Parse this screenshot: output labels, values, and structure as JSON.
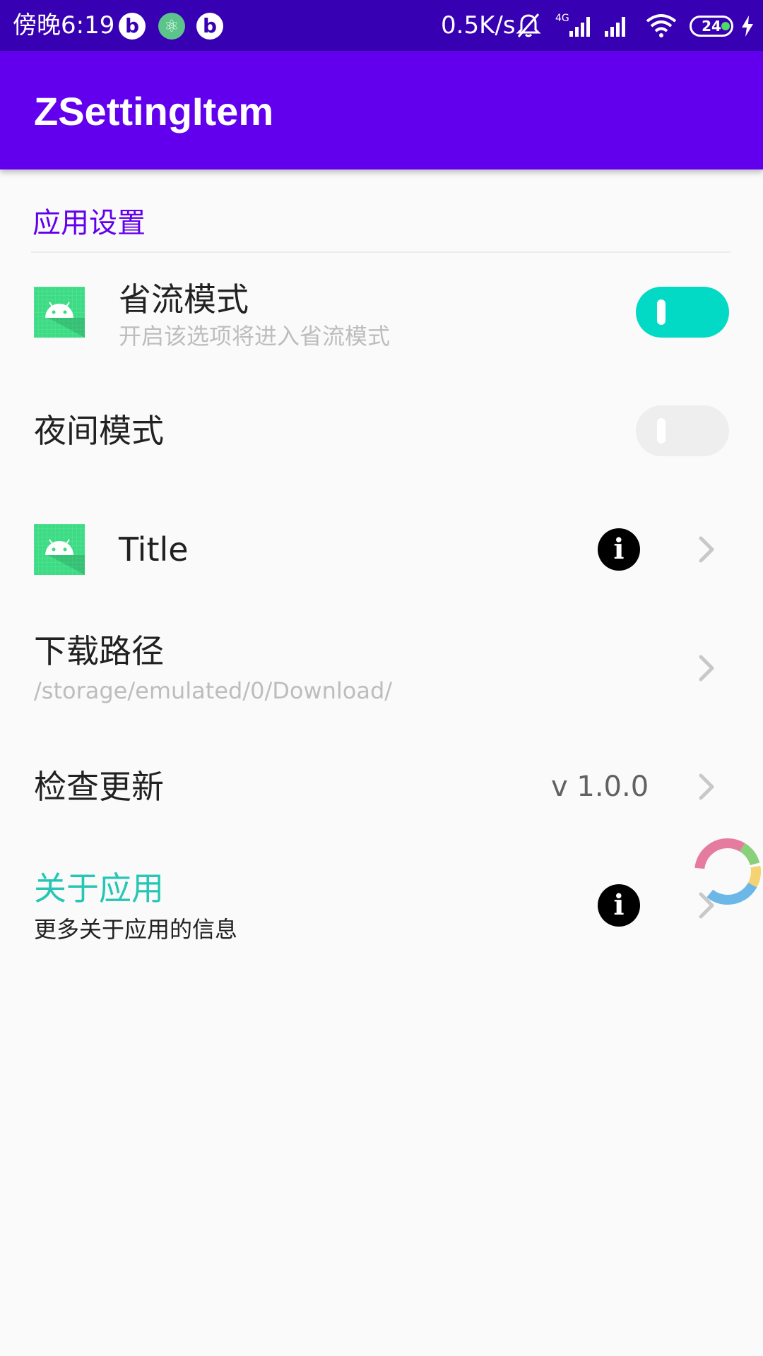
{
  "status_bar": {
    "time": "傍晚6:19",
    "network_speed": "0.5K/s",
    "battery_level": "24",
    "icons": [
      "bilibili-icon",
      "atom-icon",
      "bilibili-icon",
      "mute-bell-icon",
      "4g-signal-icon",
      "signal-icon",
      "wifi-icon",
      "battery-icon",
      "charging-icon"
    ]
  },
  "app_bar": {
    "title": "ZSettingItem"
  },
  "section": {
    "title": "应用设置"
  },
  "items": {
    "data_saver": {
      "title": "省流模式",
      "subtitle": "开启该选项将进入省流模式",
      "switch_on": true,
      "icon": "android-icon"
    },
    "night_mode": {
      "title": "夜间模式",
      "switch_on": false
    },
    "title_item": {
      "title": "Title",
      "icon": "android-icon",
      "info_icon": "info-icon"
    },
    "download_path": {
      "title": "下载路径",
      "subtitle": "/storage/emulated/0/Download/"
    },
    "check_update": {
      "title": "检查更新",
      "value": "v 1.0.0"
    },
    "about": {
      "title": "关于应用",
      "subtitle": "更多关于应用的信息",
      "title_color": "#26c6b5",
      "info_icon": "info-icon"
    }
  },
  "colors": {
    "status_bar": "#3700b3",
    "primary": "#6200ee",
    "accent": "#03dac5",
    "android_green": "#3ddc84"
  }
}
